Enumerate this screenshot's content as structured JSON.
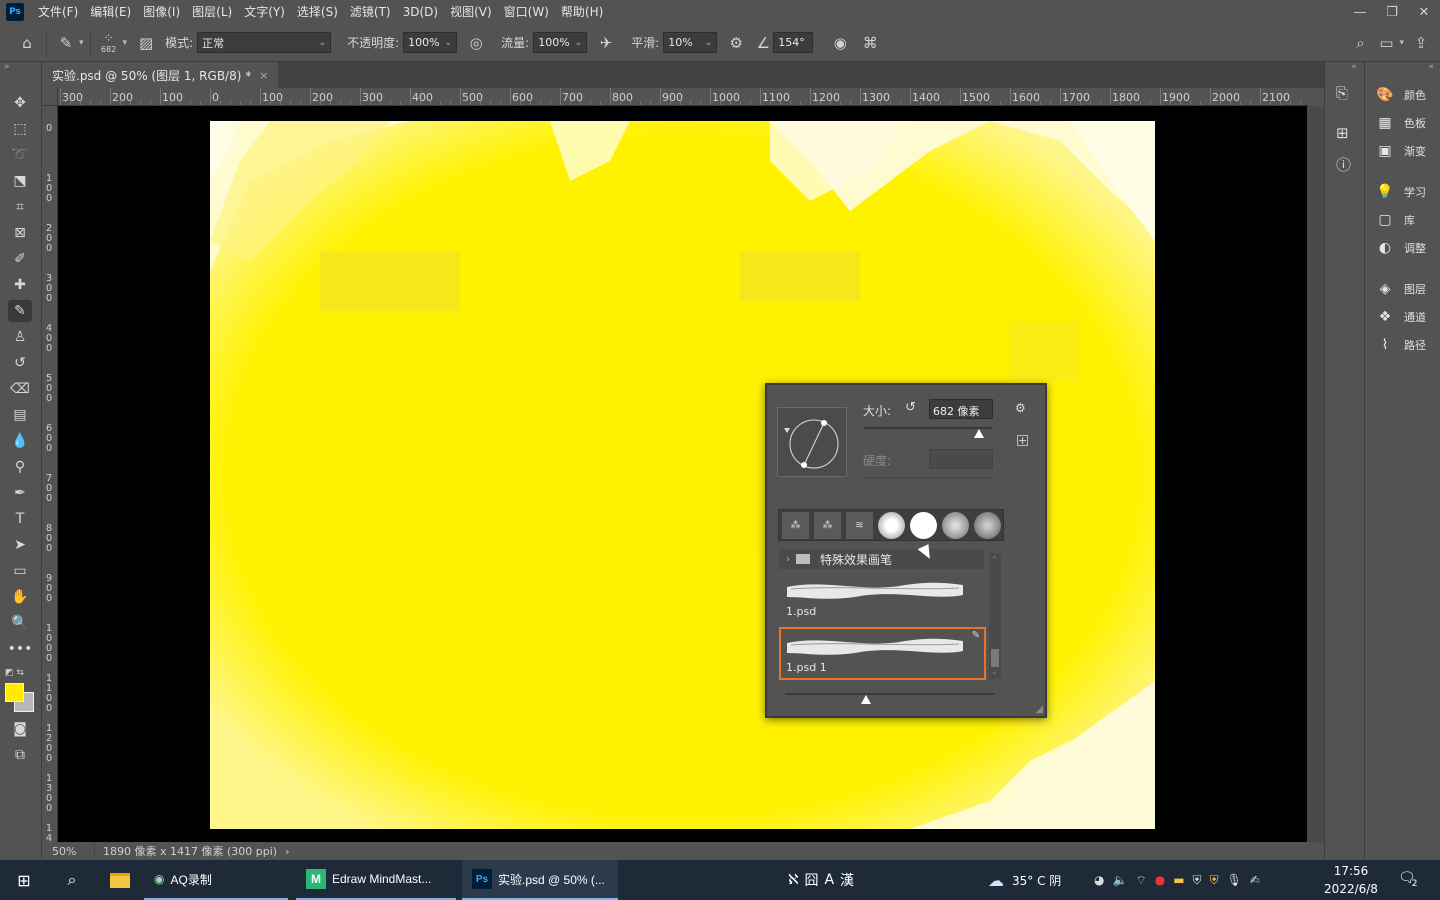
{
  "app": {
    "logo": "Ps"
  },
  "menu": [
    "文件(F)",
    "编辑(E)",
    "图像(I)",
    "图层(L)",
    "文字(Y)",
    "选择(S)",
    "滤镜(T)",
    "3D(D)",
    "视图(V)",
    "窗口(W)",
    "帮助(H)"
  ],
  "window_controls": {
    "minimize": "—",
    "restore": "❐",
    "close": "✕"
  },
  "options": {
    "brush_size": "682",
    "mode_label": "模式:",
    "mode_value": "正常",
    "opacity_label": "不透明度:",
    "opacity_value": "100%",
    "flow_label": "流量:",
    "flow_value": "100%",
    "smoothing_label": "平滑:",
    "smoothing_value": "10%",
    "angle_value": "154°"
  },
  "document_tab": {
    "title": "实验.psd @ 50% (图层 1, RGB/8) *",
    "close": "×"
  },
  "ruler_top": [
    "300",
    "200",
    "100",
    "0",
    "100",
    "200",
    "300",
    "400",
    "500",
    "600",
    "700",
    "800",
    "900",
    "1000",
    "1100",
    "1200",
    "1300",
    "1400",
    "1500",
    "1600",
    "1700",
    "1800",
    "1900",
    "2000",
    "2100"
  ],
  "ruler_left": [
    "0",
    "1\n0\n0",
    "2\n0\n0",
    "3\n0\n0",
    "4\n0\n0",
    "5\n0\n0",
    "6\n0\n0",
    "7\n0\n0",
    "8\n0\n0",
    "9\n0\n0",
    "1\n0\n0\n0",
    "1\n1\n0\n0",
    "1\n2\n0\n0",
    "1\n3\n0\n0",
    "1\n4"
  ],
  "status": {
    "zoom": "50%",
    "info": "1890 像素 x 1417 像素 (300 ppi)",
    "arrow": "›"
  },
  "brush_picker": {
    "size_label": "大小:",
    "size_value": "682 像素",
    "hardness_label": "硬度:",
    "group_name": "特殊效果画笔",
    "brushes": [
      {
        "name": "1.psd"
      },
      {
        "name": "1.psd 1"
      }
    ]
  },
  "right_panels": [
    {
      "icon": "palette-icon",
      "glyph": "🎨",
      "label": "颜色"
    },
    {
      "icon": "swatches-icon",
      "glyph": "▦",
      "label": "色板"
    },
    {
      "icon": "gradient-icon",
      "glyph": "▣",
      "label": "渐变"
    },
    {
      "icon": "learn-icon",
      "glyph": "💡",
      "label": "学习"
    },
    {
      "icon": "library-icon",
      "glyph": "▢",
      "label": "库"
    },
    {
      "icon": "adjust-icon",
      "glyph": "◐",
      "label": "调整"
    },
    {
      "icon": "layers-icon",
      "glyph": "◈",
      "label": "图层"
    },
    {
      "icon": "channels-icon",
      "glyph": "❖",
      "label": "通道"
    },
    {
      "icon": "paths-icon",
      "glyph": "⌇",
      "label": "路径"
    }
  ],
  "taskbar": {
    "apps": [
      {
        "label": "AQ录制"
      },
      {
        "label": "Edraw MindMast..."
      },
      {
        "label": "实验.psd @ 50% (..."
      }
    ],
    "ime": [
      "ℵ",
      "囧",
      "A",
      "漢"
    ],
    "weather": "35° C 阴",
    "time": "17:56",
    "date": "2022/6/8",
    "notifications": "2"
  },
  "colors": {
    "canvas_yellow": "#fff200",
    "foreground": "#ffea00",
    "accent_orange": "#e8742a"
  }
}
